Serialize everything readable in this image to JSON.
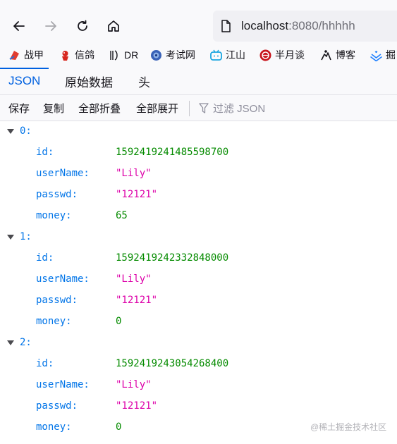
{
  "browser": {
    "url_host": "localhost",
    "url_rest": ":8080/hhhhh"
  },
  "bookmarks": [
    {
      "label": "战甲",
      "icon": "red-shield-icon"
    },
    {
      "label": "信鸽",
      "icon": "pigeon-icon"
    },
    {
      "label": "DR",
      "icon": "dr-logo-icon"
    },
    {
      "label": "考试网",
      "icon": "globe-icon"
    },
    {
      "label": "江山",
      "icon": "bilibili-tv-icon"
    },
    {
      "label": "半月谈",
      "icon": "red-circle-icon"
    },
    {
      "label": "博客",
      "icon": "person-icon"
    },
    {
      "label": "掘",
      "icon": "juejin-icon"
    }
  ],
  "tabs": [
    {
      "label": "JSON",
      "active": true
    },
    {
      "label": "原始数据",
      "active": false
    },
    {
      "label": "头",
      "active": false
    }
  ],
  "toolbar": {
    "save": "保存",
    "copy": "复制",
    "collapse_all": "全部折叠",
    "expand_all": "全部展开",
    "filter_placeholder": "过滤 JSON"
  },
  "records": [
    {
      "index": "0:",
      "fields": [
        {
          "key": "id:",
          "value": "1592419241485598700",
          "type": "num"
        },
        {
          "key": "userName:",
          "value": "\"Lily\"",
          "type": "str"
        },
        {
          "key": "passwd:",
          "value": "\"12121\"",
          "type": "str"
        },
        {
          "key": "money:",
          "value": "65",
          "type": "num"
        }
      ]
    },
    {
      "index": "1:",
      "fields": [
        {
          "key": "id:",
          "value": "1592419242332848000",
          "type": "num"
        },
        {
          "key": "userName:",
          "value": "\"Lily\"",
          "type": "str"
        },
        {
          "key": "passwd:",
          "value": "\"12121\"",
          "type": "str"
        },
        {
          "key": "money:",
          "value": "0",
          "type": "num"
        }
      ]
    },
    {
      "index": "2:",
      "fields": [
        {
          "key": "id:",
          "value": "1592419243054268400",
          "type": "num"
        },
        {
          "key": "userName:",
          "value": "\"Lily\"",
          "type": "str"
        },
        {
          "key": "passwd:",
          "value": "\"12121\"",
          "type": "str"
        },
        {
          "key": "money:",
          "value": "0",
          "type": "num"
        }
      ]
    }
  ],
  "watermark": "@稀土掘金技术社区",
  "colors": {
    "accent": "#0061e0",
    "json_key": "#0074e8",
    "json_number": "#058b00",
    "json_string": "#dd00a9"
  }
}
